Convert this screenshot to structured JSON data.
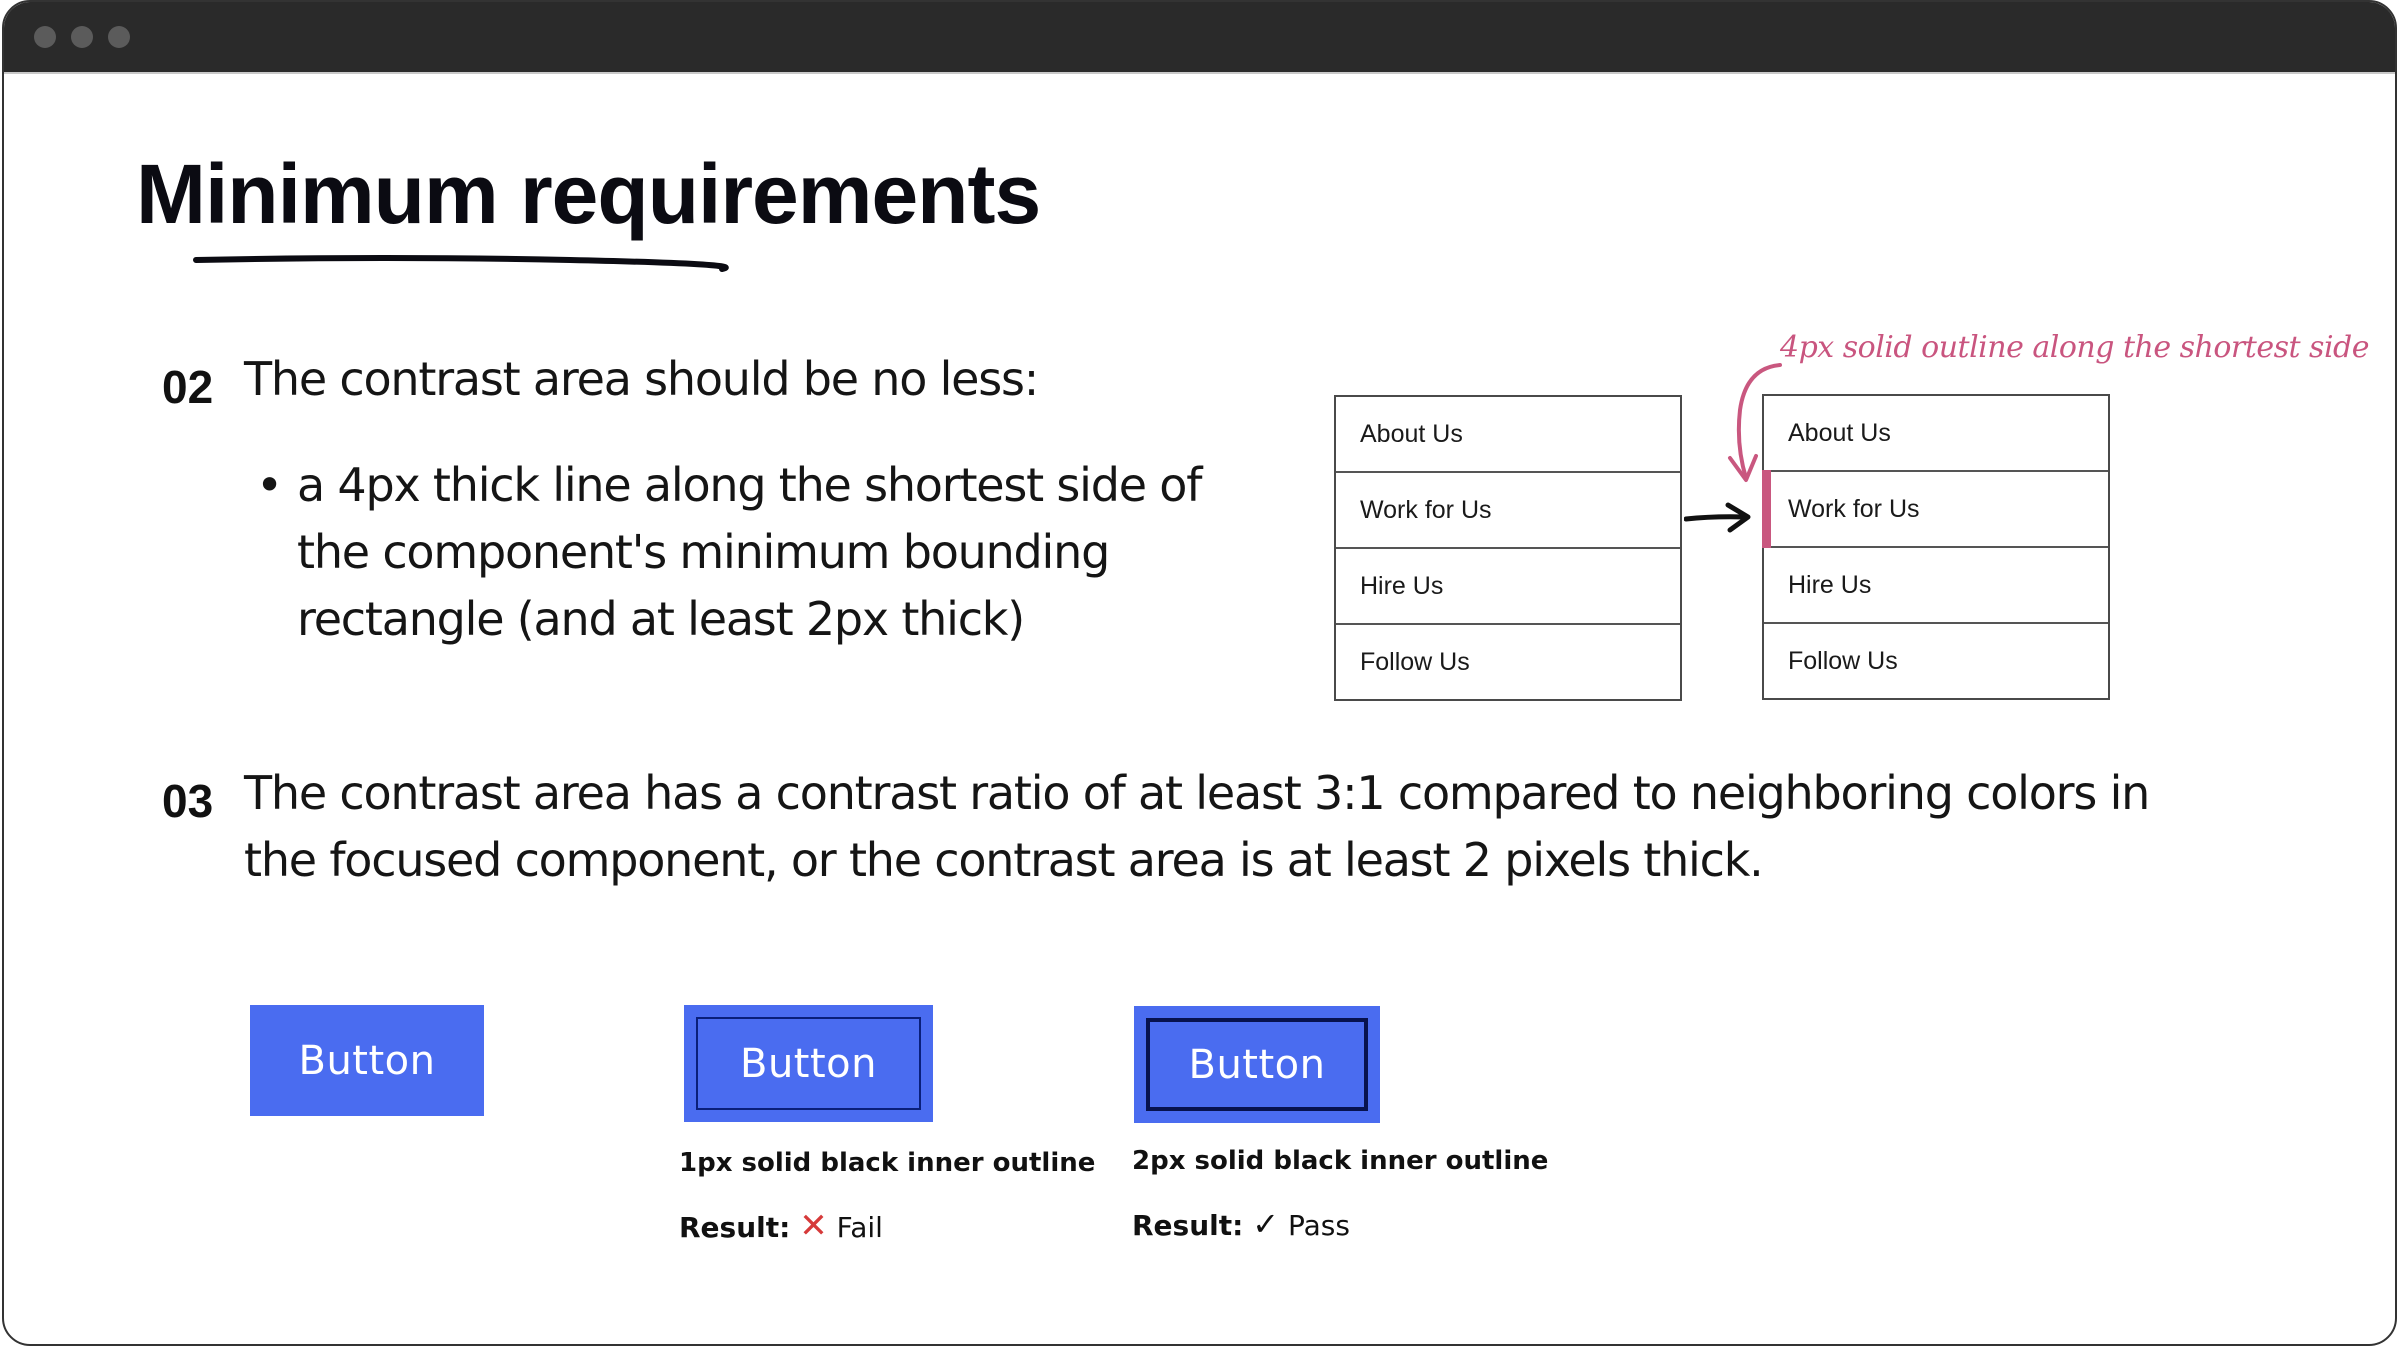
{
  "window": {
    "controls": [
      "close-dot",
      "minimize-dot",
      "maximize-dot"
    ]
  },
  "slide": {
    "title": "Minimum requirements",
    "section_02": {
      "number": "02",
      "heading": "The contrast area should be no less:",
      "bullet_lines": [
        "a 4px thick line along the shortest side of",
        "the component's minimum bounding",
        "rectangle (and at least 2px thick)"
      ]
    },
    "diagram": {
      "annotation": "4px solid outline along the shortest side",
      "menu_before": {
        "items": [
          "About Us",
          "Work for Us",
          "Hire Us",
          "Follow Us"
        ]
      },
      "menu_after": {
        "items": [
          "About Us",
          "Work for Us",
          "Hire Us",
          "Follow Us"
        ],
        "focused_index": 1
      },
      "colors": {
        "focus": "#c9577f"
      }
    },
    "section_03": {
      "number": "03",
      "lines": [
        "The contrast area has a contrast ratio of at least 3:1 compared to neighboring colors in",
        "the focused component, or the contrast area is at least 2 pixels thick."
      ]
    },
    "examples": [
      {
        "button_label": "Button"
      },
      {
        "button_label": "Button",
        "caption": "1px solid black inner outline",
        "result_label": "Result:",
        "result_icon": "cross-icon",
        "result_value": "Fail"
      },
      {
        "button_label": "Button",
        "caption": "2px solid black inner outline",
        "result_label": "Result:",
        "result_icon": "check-icon",
        "result_value": "Pass"
      }
    ],
    "colors": {
      "button": "#4a6cf0",
      "fail": "#d63a3a"
    }
  }
}
